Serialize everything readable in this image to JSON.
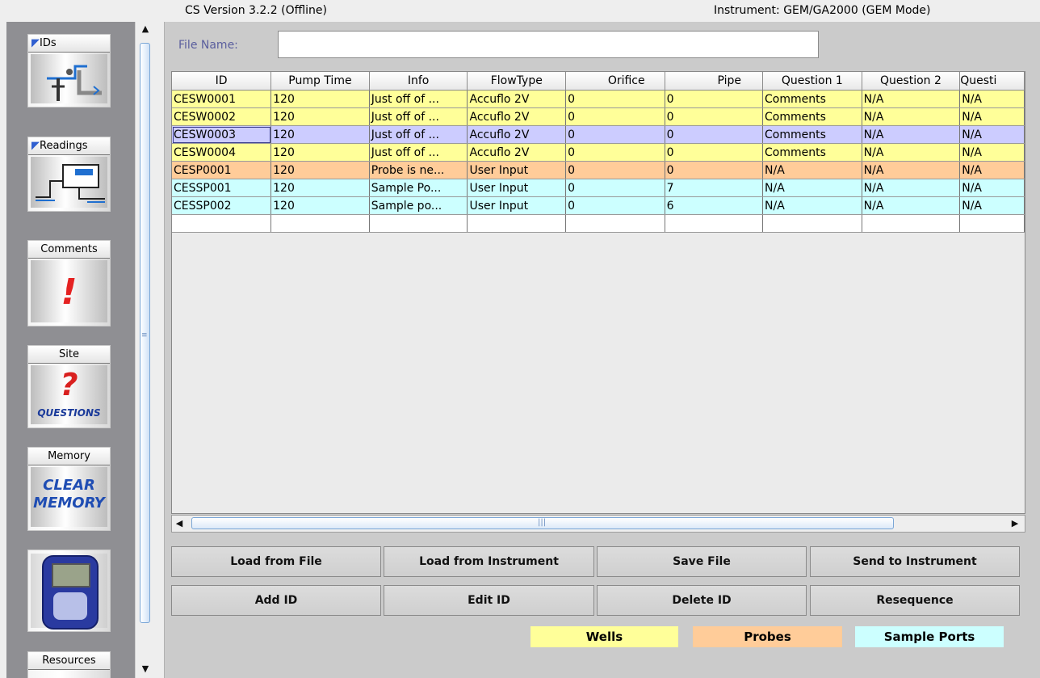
{
  "header": {
    "version": "CS Version 3.2.2 (Offline)",
    "instrument": "Instrument: GEM/GA2000 (GEM Mode)"
  },
  "sidebar": {
    "items": [
      {
        "label": "IDs",
        "icon": "ids-pipe-icon"
      },
      {
        "label": "Readings",
        "icon": "readings-meter-icon"
      },
      {
        "label": "Comments",
        "icon": "exclamation-icon"
      },
      {
        "label": "Site",
        "icon": "question-icon",
        "caption": "QUESTIONS"
      },
      {
        "label": "Memory",
        "icon": "clear-memory-icon",
        "caption_lines": [
          "CLEAR",
          "MEMORY"
        ]
      },
      {
        "label": "",
        "icon": "instrument-device-icon"
      },
      {
        "label": "Resources",
        "icon": "resources-icon"
      }
    ]
  },
  "file": {
    "label": "File Name:",
    "value": ""
  },
  "table": {
    "columns": [
      "ID",
      "Pump Time",
      "Info",
      "FlowType",
      "Orifice",
      "Pipe",
      "Question 1",
      "Question 2",
      "Questi"
    ],
    "rows": [
      {
        "type": "well",
        "cells": [
          "CESW0001",
          "120",
          "Just off of ...",
          "Accuflo 2V",
          "0",
          "0",
          "Comments",
          "N/A",
          "N/A"
        ]
      },
      {
        "type": "well",
        "cells": [
          "CESW0002",
          "120",
          "Just off of ...",
          "Accuflo 2V",
          "0",
          "0",
          "Comments",
          "N/A",
          "N/A"
        ]
      },
      {
        "type": "sel",
        "cells": [
          "CESW0003",
          "120",
          "Just off of ...",
          "Accuflo 2V",
          "0",
          "0",
          "Comments",
          "N/A",
          "N/A"
        ]
      },
      {
        "type": "well",
        "cells": [
          "CESW0004",
          "120",
          "Just off of ...",
          "Accuflo 2V",
          "0",
          "0",
          "Comments",
          "N/A",
          "N/A"
        ]
      },
      {
        "type": "probe",
        "cells": [
          "CESP0001",
          "120",
          "Probe is ne...",
          "User Input",
          "0",
          "0",
          "N/A",
          "N/A",
          "N/A"
        ]
      },
      {
        "type": "port",
        "cells": [
          "CESSP001",
          "120",
          "Sample Po...",
          "User Input",
          "0",
          "7",
          "N/A",
          "N/A",
          "N/A"
        ]
      },
      {
        "type": "port",
        "cells": [
          "CESSP002",
          "120",
          "Sample po...",
          "User Input",
          "0",
          "6",
          "N/A",
          "N/A",
          "N/A"
        ]
      },
      {
        "type": "blank",
        "cells": [
          "",
          "",
          "",
          "",
          "",
          "",
          "",
          "",
          ""
        ]
      }
    ]
  },
  "buttons": {
    "load_file": "Load from File",
    "load_instrument": "Load from Instrument",
    "save_file": "Save File",
    "send_instrument": "Send to Instrument",
    "add_id": "Add ID",
    "edit_id": "Edit ID",
    "delete_id": "Delete ID",
    "resequence": "Resequence"
  },
  "legend": {
    "wells": "Wells",
    "probes": "Probes",
    "ports": "Sample Ports",
    "colors": {
      "wells": "#ffff99",
      "probes": "#ffcc99",
      "ports": "#ccffff",
      "selected": "#ccccff"
    }
  }
}
